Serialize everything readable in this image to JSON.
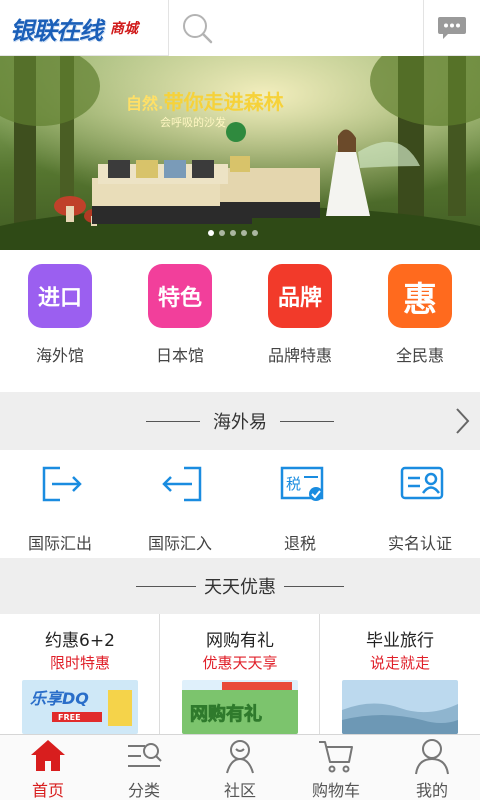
{
  "header": {
    "logo_main": "银联在线",
    "logo_sub": "商城",
    "search_placeholder": ""
  },
  "banner": {
    "lead": "自然.",
    "title": "带你走进森林",
    "subtitle": "会呼吸的沙发",
    "page_count": 5,
    "active_index": 0
  },
  "quick_categories": [
    {
      "icon_text": "进口",
      "label": "海外馆",
      "color": "#9b5ff0"
    },
    {
      "icon_text": "特色",
      "label": "日本馆",
      "color": "#f23f9b"
    },
    {
      "icon_text": "品牌",
      "label": "品牌特惠",
      "color": "#f23a2a"
    },
    {
      "icon_text": "惠",
      "label": "全民惠",
      "color": "#ff6a1e"
    }
  ],
  "section_overseas": {
    "title": "海外易",
    "items": [
      {
        "label": "国际汇出",
        "icon": "remit-out-icon"
      },
      {
        "label": "国际汇入",
        "icon": "remit-in-icon"
      },
      {
        "label": "退税",
        "icon": "tax-refund-icon"
      },
      {
        "label": "实名认证",
        "icon": "id-verify-icon"
      }
    ]
  },
  "section_daily": {
    "title": "天天优惠",
    "deals": [
      {
        "title": "约惠6+2",
        "subtitle": "限时特惠"
      },
      {
        "title": "网购有礼",
        "subtitle": "优惠天天享"
      },
      {
        "title": "毕业旅行",
        "subtitle": "说走就走"
      }
    ]
  },
  "bottom_nav": [
    {
      "label": "首页",
      "icon": "home-icon",
      "active": true
    },
    {
      "label": "分类",
      "icon": "category-icon",
      "active": false
    },
    {
      "label": "社区",
      "icon": "community-icon",
      "active": false
    },
    {
      "label": "购物车",
      "icon": "cart-icon",
      "active": false
    },
    {
      "label": "我的",
      "icon": "profile-icon",
      "active": false
    }
  ],
  "colors": {
    "accent_blue": "#1a8ce0",
    "active_red": "#d81e1e",
    "deal_red": "#e0202a"
  }
}
